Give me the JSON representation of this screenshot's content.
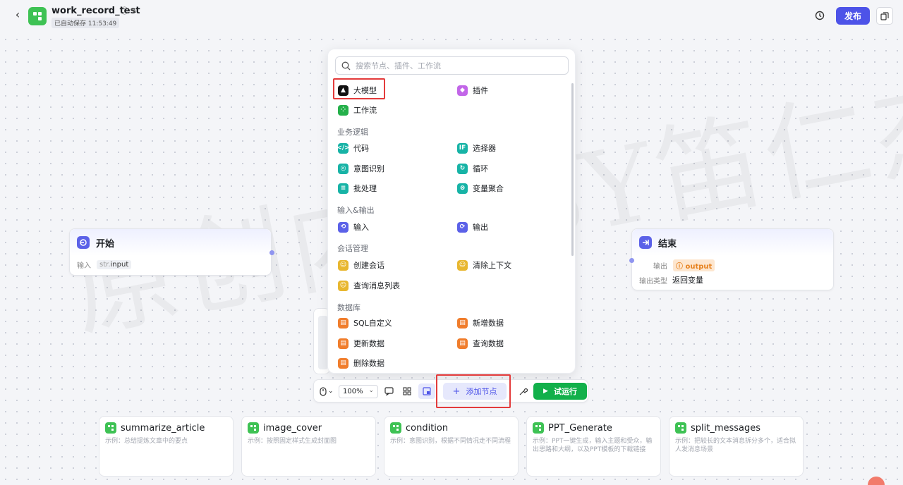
{
  "app": {
    "title": "work_record_test",
    "autosave": "已自动保存 11:53:49",
    "publish_label": "发布",
    "back_icon": "chevron-left-icon",
    "brand_color": "#4d53e8"
  },
  "watermark": "原创内容BY笛仁杰",
  "start_node": {
    "title": "开始",
    "field_label": "输入",
    "field_type": "str.",
    "field_name": "input"
  },
  "end_node": {
    "title": "结束",
    "output_label": "输出",
    "output_tag": "output",
    "output_type_label": "输出类型",
    "output_type_value": "返回变量"
  },
  "node_panel": {
    "search_placeholder": "搜索节点、插件、工作流",
    "top_items": [
      {
        "label": "大模型",
        "icon": "llm-icon",
        "color": "#111111"
      },
      {
        "label": "插件",
        "icon": "plugin-icon",
        "color": "#c266e8"
      },
      {
        "label": "工作流",
        "icon": "workflow-icon",
        "color": "#24b04a"
      }
    ],
    "sections": [
      {
        "title": "业务逻辑",
        "items": [
          {
            "label": "代码",
            "icon": "code-icon",
            "color": "#17b3a6"
          },
          {
            "label": "选择器",
            "icon": "if-selector-icon",
            "color": "#17b3a6"
          },
          {
            "label": "意图识别",
            "icon": "intent-icon",
            "color": "#17b3a6"
          },
          {
            "label": "循环",
            "icon": "loop-icon",
            "color": "#17b3a6"
          },
          {
            "label": "批处理",
            "icon": "batch-icon",
            "color": "#17b3a6"
          },
          {
            "label": "变量聚合",
            "icon": "variable-merge-icon",
            "color": "#17b3a6"
          }
        ]
      },
      {
        "title": "输入&输出",
        "items": [
          {
            "label": "输入",
            "icon": "input-icon",
            "color": "#5b61e8"
          },
          {
            "label": "输出",
            "icon": "output-icon",
            "color": "#5b61e8"
          }
        ]
      },
      {
        "title": "会话管理",
        "items": [
          {
            "label": "创建会话",
            "icon": "create-session-icon",
            "color": "#e8b730"
          },
          {
            "label": "清除上下文",
            "icon": "clear-context-icon",
            "color": "#e8b730"
          },
          {
            "label": "查询消息列表",
            "icon": "message-list-icon",
            "color": "#e8b730"
          }
        ]
      },
      {
        "title": "数据库",
        "items": [
          {
            "label": "SQL自定义",
            "icon": "sql-icon",
            "color": "#f07d2c"
          },
          {
            "label": "新增数据",
            "icon": "add-data-icon",
            "color": "#f07d2c"
          },
          {
            "label": "更新数据",
            "icon": "update-data-icon",
            "color": "#f07d2c"
          },
          {
            "label": "查询数据",
            "icon": "query-data-icon",
            "color": "#f07d2c"
          },
          {
            "label": "删除数据",
            "icon": "delete-data-icon",
            "color": "#f07d2c"
          }
        ]
      }
    ]
  },
  "toolbar": {
    "zoom": "100%",
    "add_node_label": "添加节点",
    "run_label": "试运行"
  },
  "templates": [
    {
      "name": "summarize_article",
      "desc": "示例：总结提炼文章中的要点"
    },
    {
      "name": "image_cover",
      "desc": "示例：按照固定样式生成封面图"
    },
    {
      "name": "condition",
      "desc": "示例：意图识别，根据不同情况走不同流程"
    },
    {
      "name": "PPT_Generate",
      "desc": "示例：PPT一键生成，输入主题和受众，输出思路和大纲，以及PPT模板的下载链接"
    },
    {
      "name": "split_messages",
      "desc": "示例：把较长的文本消息拆分多个，适合拟人发消息场景"
    }
  ]
}
